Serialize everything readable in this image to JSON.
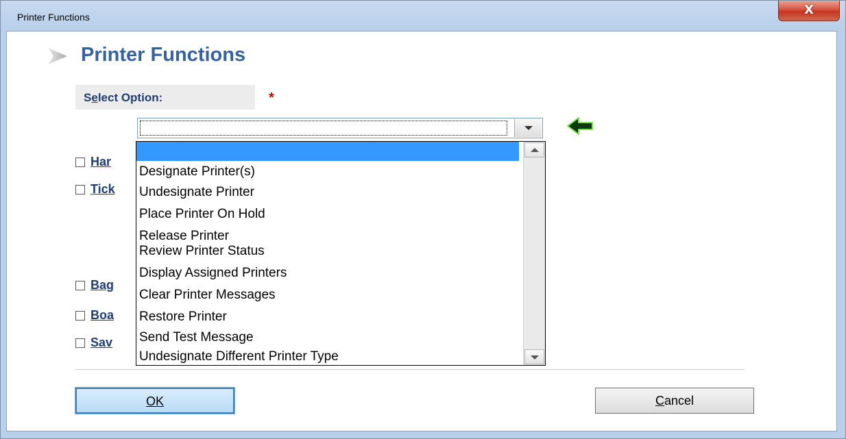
{
  "window": {
    "title": "Printer Functions",
    "close_glyph": "X"
  },
  "page": {
    "title": "Printer Functions"
  },
  "select": {
    "label_prefix": "S",
    "label_accel": "e",
    "label_suffix": "lect Option:",
    "required_mark": "*",
    "current_value": ""
  },
  "dropdown": {
    "highlighted_index": 0,
    "options": [
      "",
      "Designate Printer(s)",
      "Undesignate Printer",
      "Place Printer On Hold",
      "Release Printer",
      "Review Printer Status",
      "Display Assigned Printers",
      "Clear Printer Messages",
      "Restore Printer",
      "Send Test Message",
      "Undesignate Different Printer Type"
    ]
  },
  "options": [
    {
      "label": "Har",
      "checked": false
    },
    {
      "label": "Tick",
      "checked": false
    },
    {
      "label": "Bag",
      "checked": false
    },
    {
      "label": "Boa",
      "checked": false
    },
    {
      "label": "Sav",
      "checked": false
    }
  ],
  "buttons": {
    "ok_label": "OK",
    "cancel_label": "Cancel"
  },
  "colors": {
    "title_blue": "#36639e",
    "label_navy": "#1f3d6e",
    "required_red": "#d00000",
    "highlight_blue": "#3399ff",
    "go_arrow_green": "#2e8b22"
  }
}
